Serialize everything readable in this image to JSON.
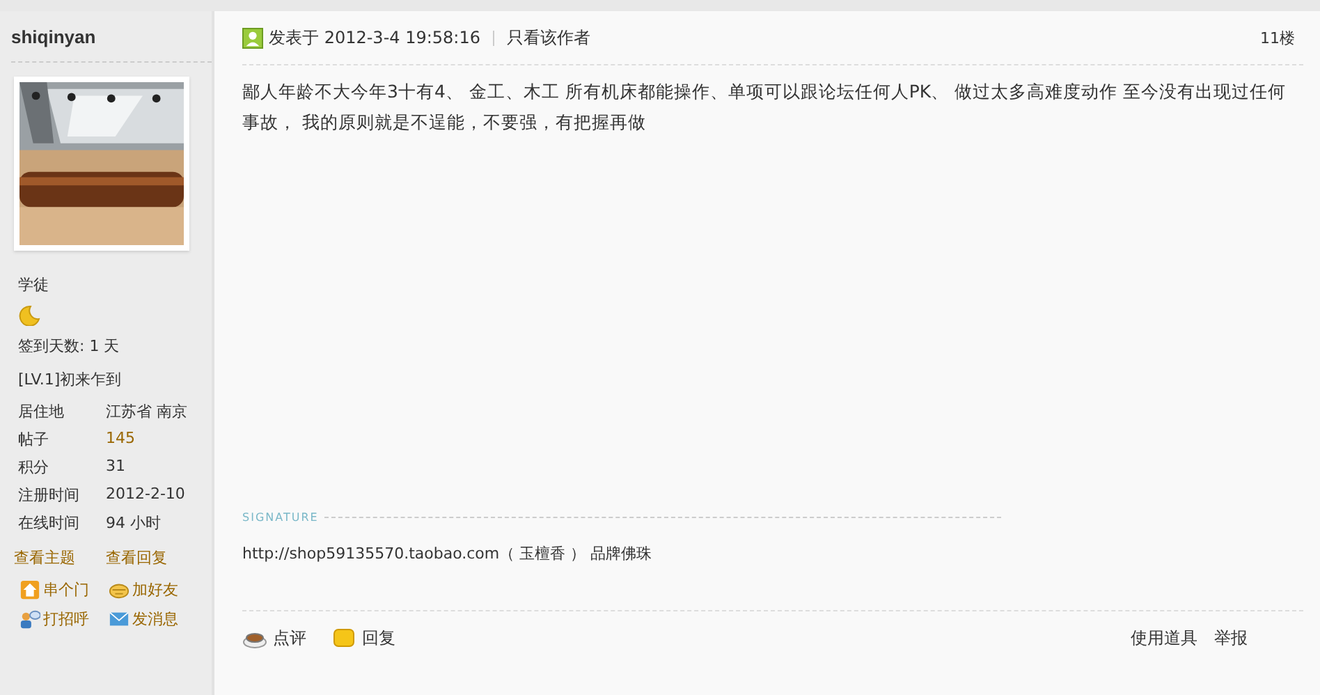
{
  "author": {
    "name": "shiqinyan",
    "rank": "学徒",
    "signin": "签到天数: 1 天",
    "level": "[LV.1]初来乍到",
    "stats": [
      {
        "label": "居住地",
        "value": "江苏省 南京",
        "link": false
      },
      {
        "label": "帖子",
        "value": "145",
        "link": true
      },
      {
        "label": "积分",
        "value": "31",
        "link": false
      },
      {
        "label": "注册时间",
        "value": "2012-2-10",
        "link": false
      },
      {
        "label": "在线时间",
        "value": "94 小时",
        "link": false
      }
    ],
    "links": [
      "查看主题",
      "查看回复"
    ],
    "actions": [
      {
        "kind": "visit",
        "label": "串个门"
      },
      {
        "kind": "friend",
        "label": "加好友"
      },
      {
        "kind": "greet",
        "label": "打招呼"
      },
      {
        "kind": "message",
        "label": "发消息"
      }
    ]
  },
  "post": {
    "posted": "发表于 2012-3-4 19:58:16",
    "author_only": "只看该作者",
    "floor": "11楼",
    "body": "鄙人年龄不大今年3十有4、 金工、木工 所有机床都能操作、单项可以跟论坛任何人PK、  做过太多高难度动作 至今没有出现过任何事故， 我的原则就是不逞能，不要强，有把握再做",
    "signature_label": "SIGNATURE",
    "signature": "http://shop59135570.taobao.com（ 玉檀香 ） 品牌佛珠",
    "footer_actions": [
      {
        "kind": "comment",
        "label": "点评"
      },
      {
        "kind": "reply",
        "label": "回复"
      }
    ],
    "footer_right": [
      "使用道具",
      "举报"
    ]
  }
}
